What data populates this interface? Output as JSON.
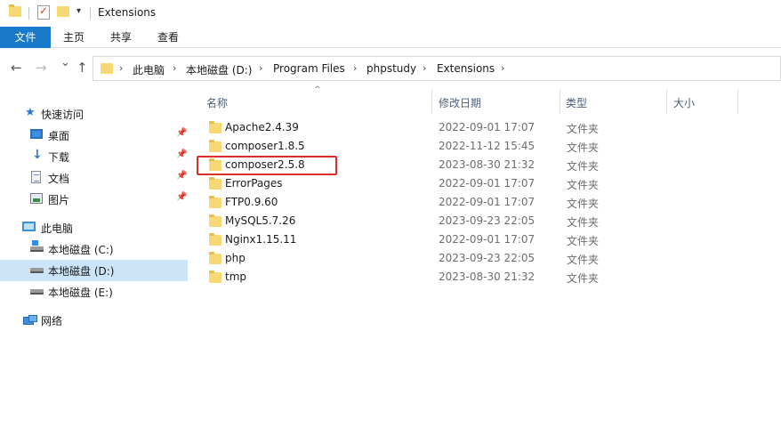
{
  "titlebar": {
    "title": "Extensions",
    "dropdown_glyph": "▾"
  },
  "ribbon": {
    "tabs": [
      {
        "label": "文件",
        "active": true
      },
      {
        "label": "主页"
      },
      {
        "label": "共享"
      },
      {
        "label": "查看"
      }
    ]
  },
  "nav": {
    "back_glyph": "←",
    "forward_glyph": "→",
    "recent_glyph": "⌄",
    "up_glyph": "↑"
  },
  "address": {
    "breadcrumbs": [
      "此电脑",
      "本地磁盘 (D:)",
      "Program Files",
      "phpstudy",
      "Extensions"
    ]
  },
  "navpane": {
    "quick_access": "快速访问",
    "quick_items": [
      {
        "label": "桌面",
        "icon": "desktop-icon",
        "pinned": true
      },
      {
        "label": "下载",
        "icon": "download-icon",
        "pinned": true
      },
      {
        "label": "文档",
        "icon": "document-icon",
        "pinned": true
      },
      {
        "label": "图片",
        "icon": "picture-icon",
        "pinned": true
      }
    ],
    "this_pc": "此电脑",
    "drives": [
      {
        "label": "本地磁盘 (C:)",
        "selected": false
      },
      {
        "label": "本地磁盘 (D:)",
        "selected": true
      },
      {
        "label": "本地磁盘 (E:)",
        "selected": false
      }
    ],
    "network": "网络",
    "pin_glyph": "📌",
    "star_glyph": "★",
    "download_glyph": "↓"
  },
  "columns": {
    "name": "名称",
    "modified": "修改日期",
    "type": "类型",
    "size": "大小",
    "sort_glyph": "^"
  },
  "files": [
    {
      "name": "Apache2.4.39",
      "modified": "2022-09-01 17:07",
      "type": "文件夹"
    },
    {
      "name": "composer1.8.5",
      "modified": "2022-11-12 15:45",
      "type": "文件夹"
    },
    {
      "name": "composer2.5.8",
      "modified": "2023-08-30 21:32",
      "type": "文件夹"
    },
    {
      "name": "ErrorPages",
      "modified": "2022-09-01 17:07",
      "type": "文件夹"
    },
    {
      "name": "FTP0.9.60",
      "modified": "2022-09-01 17:07",
      "type": "文件夹"
    },
    {
      "name": "MySQL5.7.26",
      "modified": "2023-09-23 22:05",
      "type": "文件夹"
    },
    {
      "name": "Nginx1.15.11",
      "modified": "2022-09-01 17:07",
      "type": "文件夹"
    },
    {
      "name": "php",
      "modified": "2023-09-23 22:05",
      "type": "文件夹"
    },
    {
      "name": "tmp",
      "modified": "2023-08-30 21:32",
      "type": "文件夹"
    }
  ],
  "colors": {
    "accent": "#1979ca",
    "selection": "#cce4f7",
    "highlight_box": "#d9302a",
    "folder": "#f8d775"
  }
}
